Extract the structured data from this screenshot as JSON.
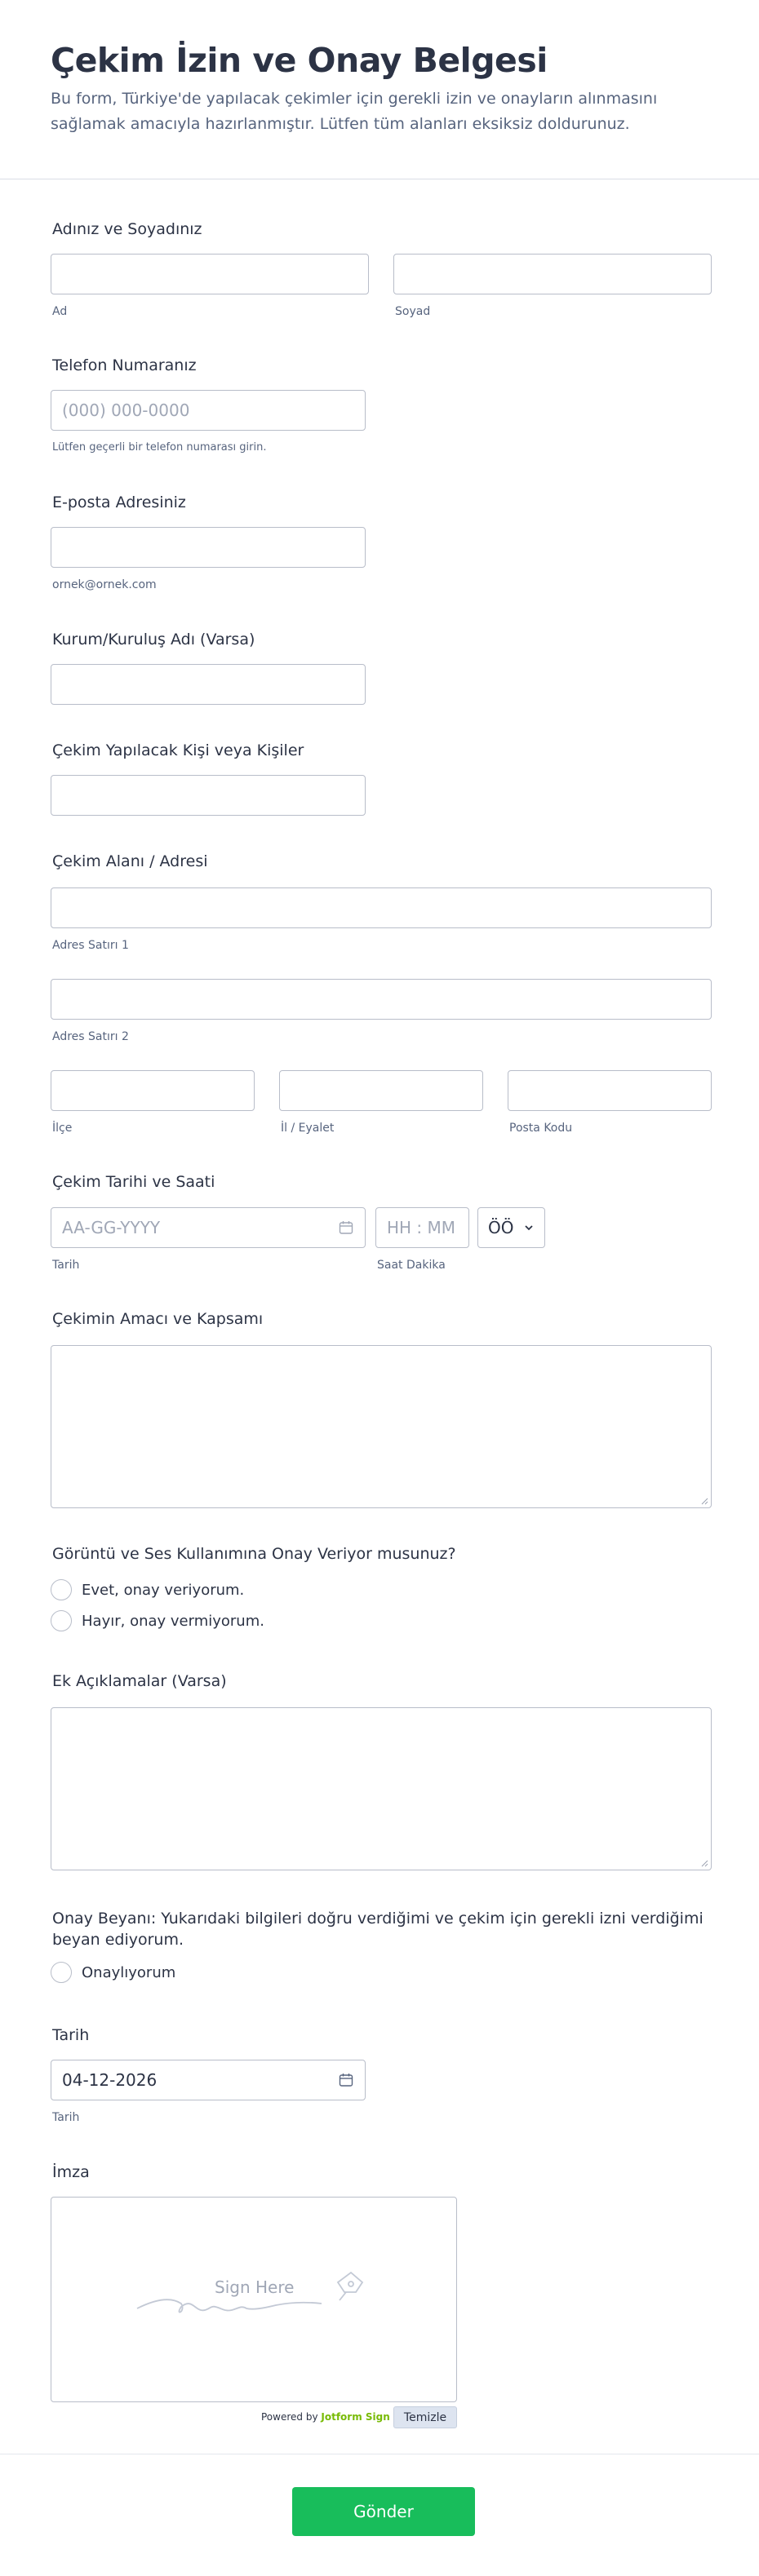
{
  "header": {
    "title": "Çekim İzin ve Onay Belgesi",
    "subtitle": "Bu form, Türkiye'de yapılacak çekimler için gerekli izin ve onayların alınmasını sağlamak amacıyla hazırlanmıştır. Lütfen tüm alanları eksiksiz doldurunuz."
  },
  "name": {
    "label": "Adınız ve Soyadınız",
    "first_sublabel": "Ad",
    "last_sublabel": "Soyad"
  },
  "phone": {
    "label": "Telefon Numaranız",
    "placeholder": "(000) 000-0000",
    "hint": "Lütfen geçerli bir telefon numarası girin."
  },
  "email": {
    "label": "E-posta Adresiniz",
    "hint": "ornek@ornek.com"
  },
  "organization": {
    "label": "Kurum/Kuruluş Adı (Varsa)"
  },
  "persons": {
    "label": "Çekim Yapılacak Kişi veya Kişiler"
  },
  "address": {
    "label": "Çekim Alanı / Adresi",
    "line1_sublabel": "Adres Satırı 1",
    "line2_sublabel": "Adres Satırı 2",
    "district_sublabel": "İlçe",
    "province_sublabel": "İl / Eyalet",
    "postal_sublabel": "Posta Kodu"
  },
  "datetime": {
    "label": "Çekim Tarihi ve Saati",
    "date_placeholder": "AA-GG-YYYY",
    "time_placeholder": "HH : MM",
    "ampm_value": "ÖÖ",
    "date_sublabel": "Tarih",
    "time_sublabel": "Saat Dakika"
  },
  "purpose": {
    "label": "Çekimin Amacı ve Kapsamı"
  },
  "consent_media": {
    "label": "Görüntü ve Ses Kullanımına Onay Veriyor musunuz?",
    "options": [
      "Evet, onay veriyorum.",
      "Hayır, onay vermiyorum."
    ]
  },
  "notes": {
    "label": "Ek Açıklamalar (Varsa)"
  },
  "declaration": {
    "label": "Onay Beyanı: Yukarıdaki bilgileri doğru verdiğimi ve çekim için gerekli izni verdiğimi beyan ediyorum.",
    "option": "Onaylıyorum"
  },
  "date": {
    "label": "Tarih",
    "value": "04-12-2026",
    "sublabel": "Tarih"
  },
  "signature": {
    "label": "İmza",
    "placeholder": "Sign Here",
    "powered_prefix": "Powered by",
    "powered_brand": "Jotform Sign",
    "clear_label": "Temizle"
  },
  "submit": {
    "label": "Gönder"
  },
  "colors": {
    "accent": "#18bd5b",
    "text": "#2c3345",
    "muted": "#57647e",
    "border": "#b8bdc9",
    "brand": "#78bb07"
  }
}
